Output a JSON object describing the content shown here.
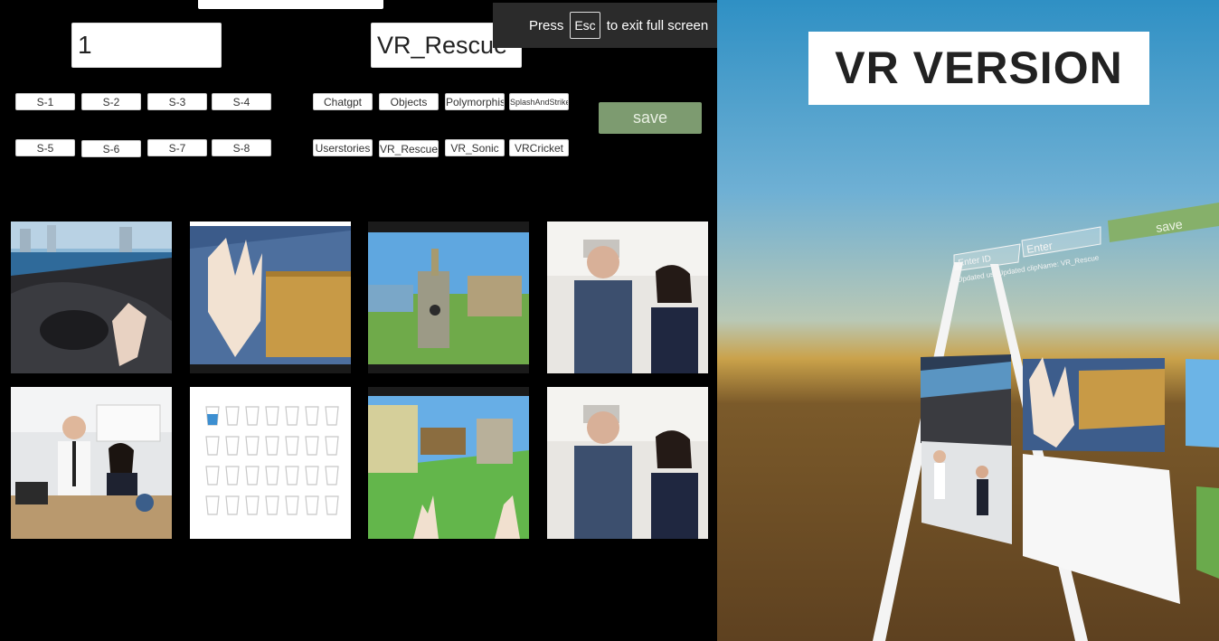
{
  "fullscreen_notice": {
    "press": "Press",
    "key": "Esc",
    "rest": "to exit full screen"
  },
  "form": {
    "user_id_value": "1",
    "clip_name_value": "VR_Rescue",
    "save_label": "save"
  },
  "session_buttons": [
    "S-1",
    "S-2",
    "S-3",
    "S-4",
    "S-5",
    "S-6",
    "S-7",
    "S-8"
  ],
  "clip_buttons": [
    "Chatgpt",
    "Objects",
    "Polymorphism",
    "SplashAndStrike",
    "Userstories",
    "VR_Rescue",
    "VR_Sonic",
    "VRCricket"
  ],
  "thumbnails": [
    "car-interior-vr",
    "vr-hand-wooden-board",
    "vr-tower-world",
    "kitchen-presenters",
    "lab-presenters",
    "glass-cups-grid",
    "vr-hands-green-field",
    "kitchen-presenters-2"
  ],
  "vr": {
    "title": "VR VERSION",
    "save_label": "save",
    "user_placeholder": "Enter ID",
    "clip_placeholder": "Enter",
    "status_user": "Updated user",
    "status_clip": "Updated clipName: VR_Rescue"
  }
}
